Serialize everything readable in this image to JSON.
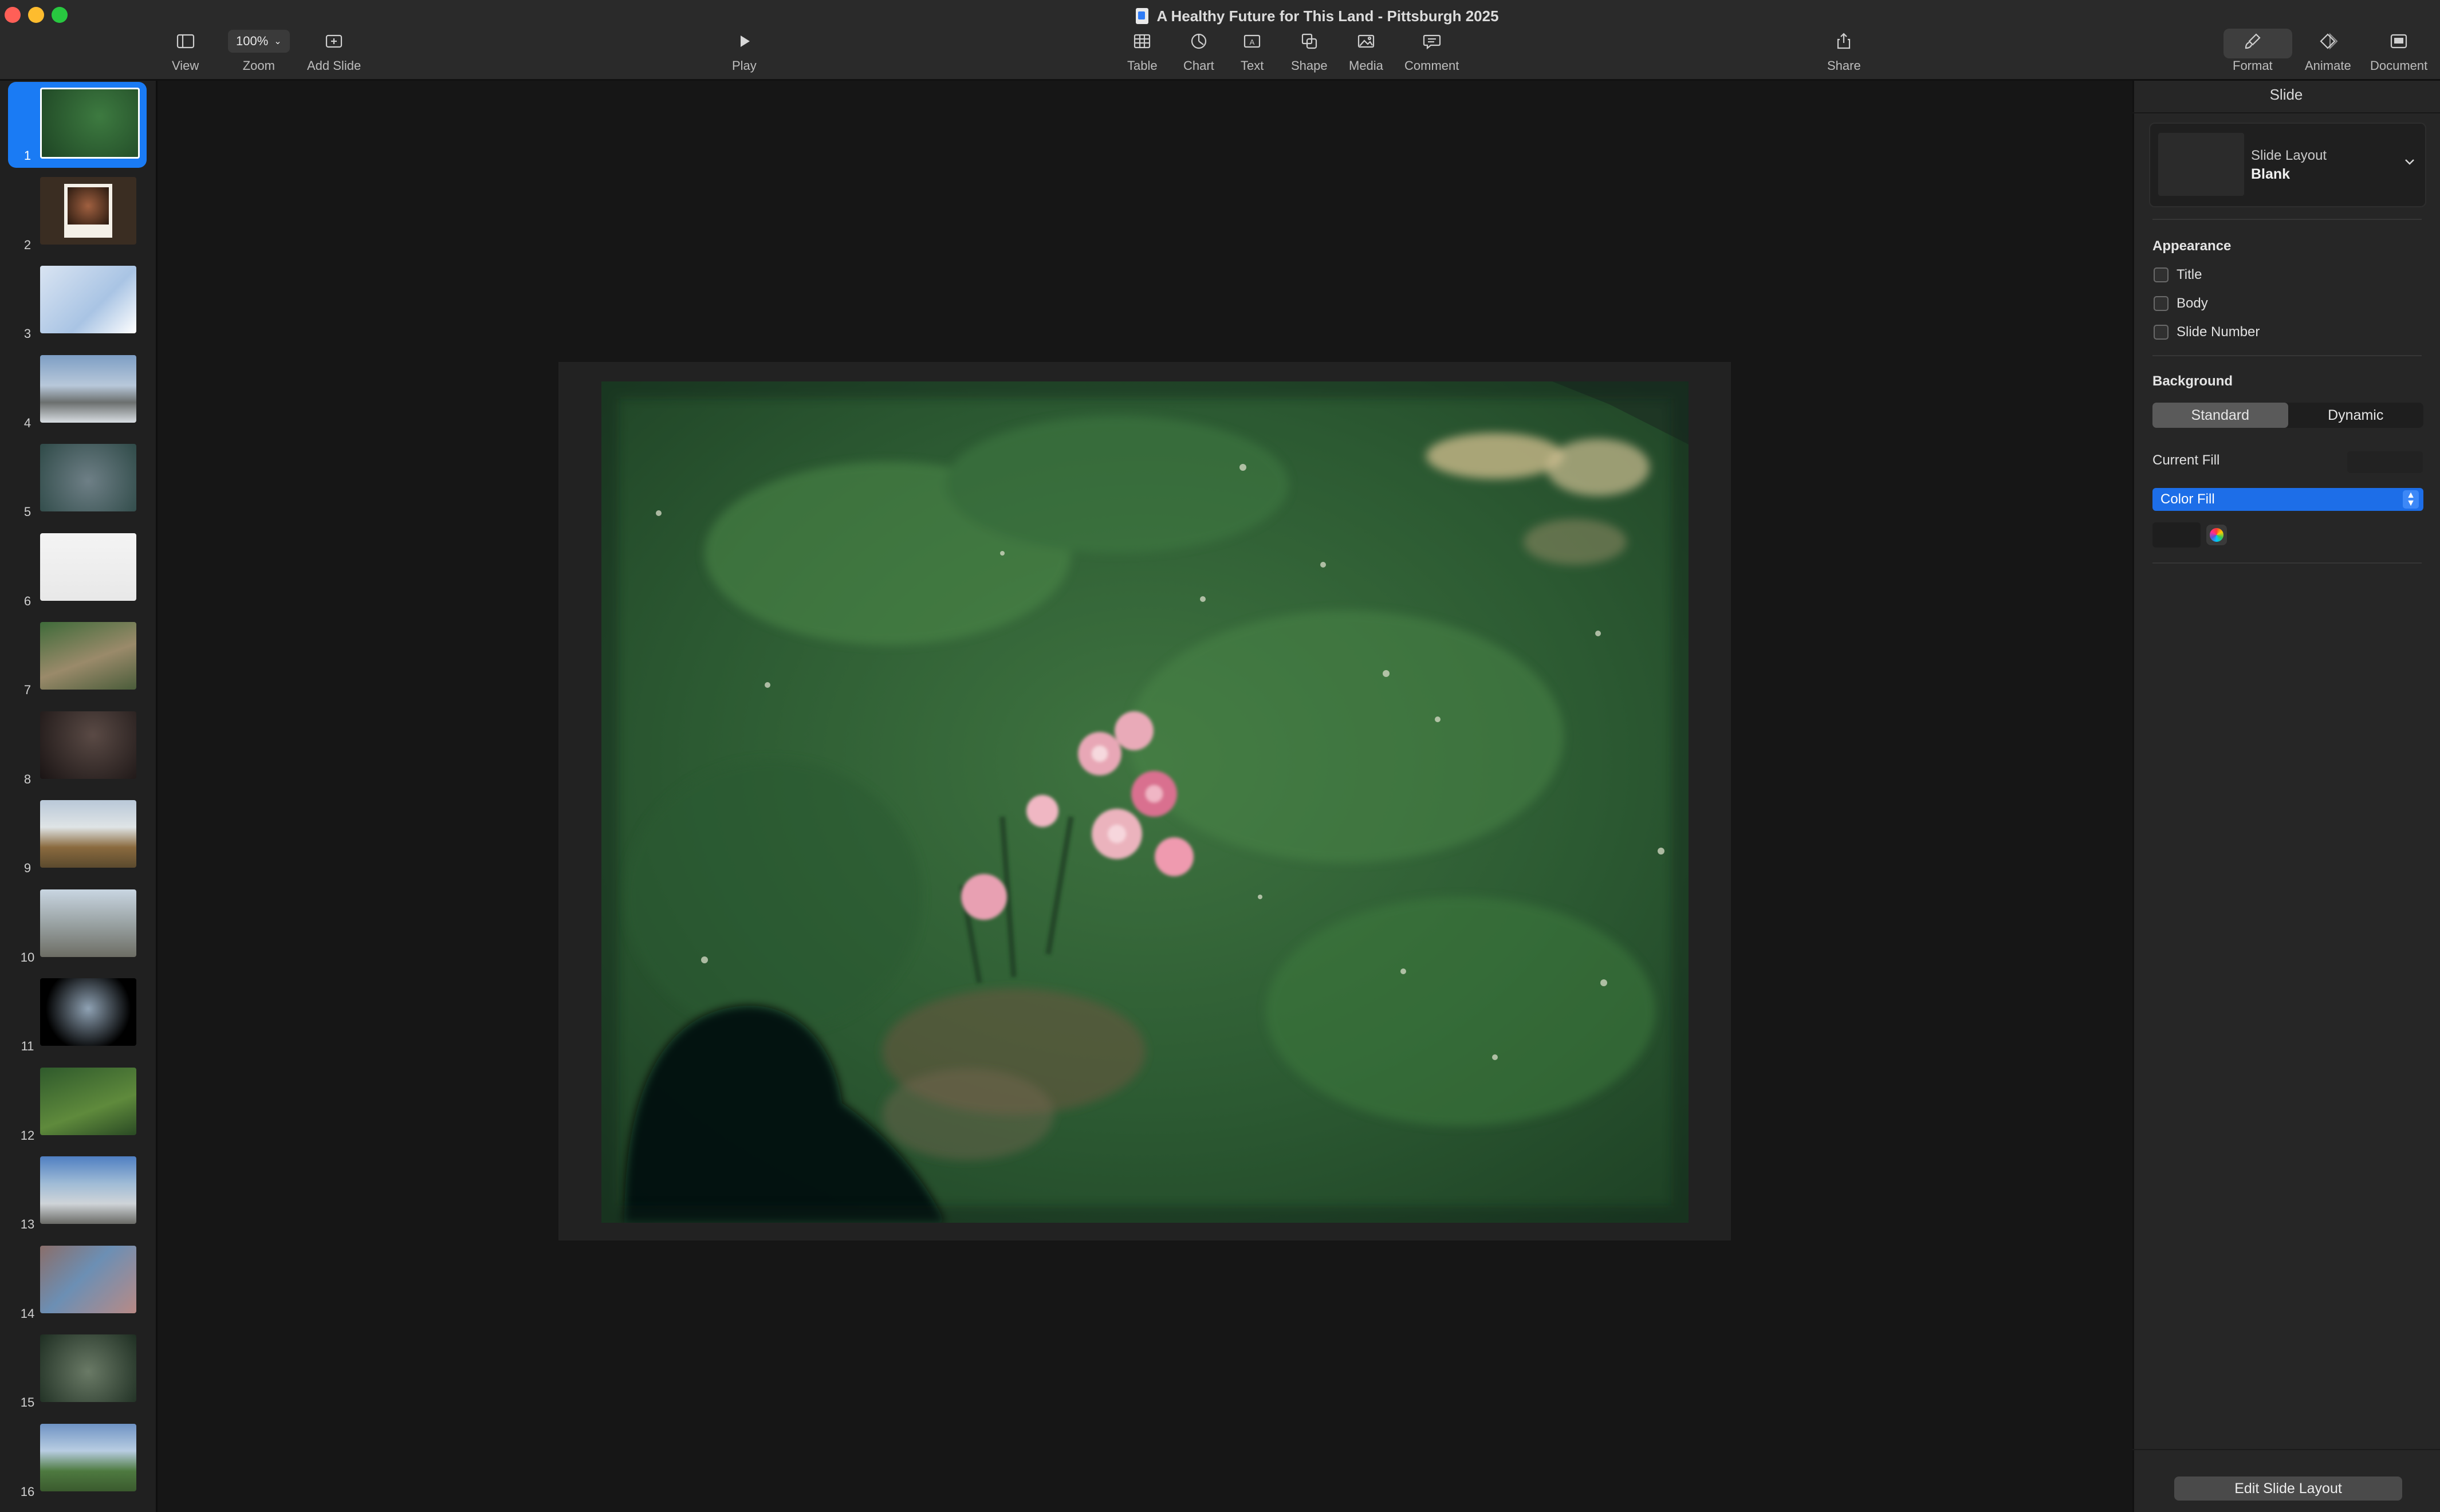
{
  "window": {
    "title": "A Healthy Future for This Land - Pittsburgh 2025"
  },
  "toolbar": {
    "view_label": "View",
    "zoom_value": "100%",
    "zoom_label": "Zoom",
    "add_slide_label": "Add Slide",
    "play_label": "Play",
    "table_label": "Table",
    "chart_label": "Chart",
    "text_label": "Text",
    "shape_label": "Shape",
    "media_label": "Media",
    "comment_label": "Comment",
    "share_label": "Share",
    "format_label": "Format",
    "animate_label": "Animate",
    "document_label": "Document"
  },
  "sidebar": {
    "selected_slide": 1,
    "slides": [
      {
        "number": "1"
      },
      {
        "number": "2"
      },
      {
        "number": "3"
      },
      {
        "number": "4"
      },
      {
        "number": "5"
      },
      {
        "number": "6"
      },
      {
        "number": "7"
      },
      {
        "number": "8"
      },
      {
        "number": "9"
      },
      {
        "number": "10"
      },
      {
        "number": "11"
      },
      {
        "number": "12"
      },
      {
        "number": "13"
      },
      {
        "number": "14"
      },
      {
        "number": "15"
      },
      {
        "number": "16"
      }
    ]
  },
  "inspector": {
    "title": "Slide",
    "slide_layout_caption": "Slide Layout",
    "slide_layout_value": "Blank",
    "appearance_heading": "Appearance",
    "appearance_options": [
      {
        "label": "Title",
        "checked": false
      },
      {
        "label": "Body",
        "checked": false
      },
      {
        "label": "Slide Number",
        "checked": false
      }
    ],
    "background_heading": "Background",
    "background_modes": [
      "Standard",
      "Dynamic"
    ],
    "background_mode_selected": "Standard",
    "current_fill_label": "Current Fill",
    "fill_type": "Color Fill",
    "edit_layout_button": "Edit Slide Layout"
  },
  "colors": {
    "accent": "#1a7bf4",
    "toolbar_bg": "#2a2a2a",
    "canvas_bg": "#161616"
  }
}
